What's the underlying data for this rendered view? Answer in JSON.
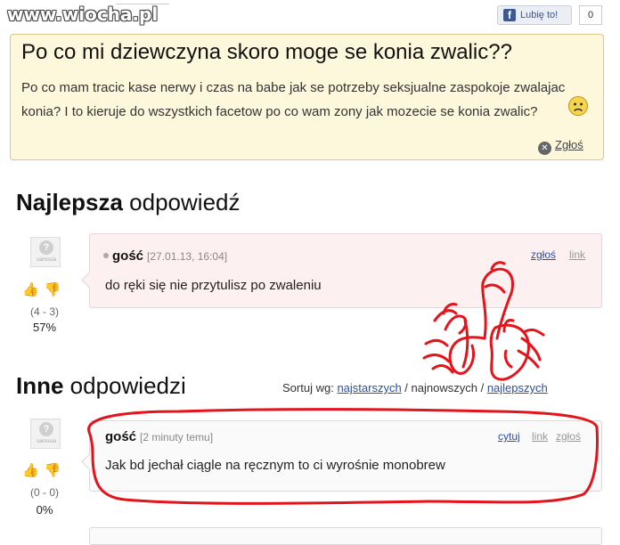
{
  "watermark": "www.wiocha.pl",
  "like_widget": {
    "label": "Lubię to!",
    "count": "0",
    "brand_color": "#3b5998"
  },
  "question": {
    "title": "Po co mi dziewczyna skoro moge se konia zwalic??",
    "body": "Po co mam tracic kase nerwy i czas na babe jak se potrzeby seksjualne zaspokoje zwalajac konia? I to kieruje do wszystkich facetow po co wam zony jak mozecie se konia zwalic?",
    "report_label": "Zgłoś",
    "emoticon": "sad-face-icon"
  },
  "best_answer": {
    "heading_bold": "Najlepsza",
    "heading_rest": " odpowiedź",
    "author": "gość",
    "date": "[27.01.13, 16:04]",
    "actions": [
      "zgłoś",
      "link"
    ],
    "text": "do ręki się nie przytulisz po zwaleniu",
    "votes": "(4 - 3)",
    "percent": "57%",
    "avatar_text": "samosia"
  },
  "other_answers": {
    "heading_bold": "Inne",
    "heading_rest": " odpowiedzi",
    "sort": {
      "label": "Sortuj wg:",
      "options": [
        "najstarszych",
        "najnowszych",
        "najlepszych"
      ],
      "separator": " / "
    },
    "items": [
      {
        "author": "gość",
        "date": "[2 minuty temu]",
        "actions": [
          "cytuj",
          "link",
          "zgłoś"
        ],
        "text": "Jak bd jechał ciągle na ręcznym to ci wyrośnie monobrew",
        "votes": "(0 - 0)",
        "percent": "0%",
        "avatar_text": "samosia"
      }
    ]
  },
  "colors": {
    "question_bg": "#fdf7dc",
    "best_bg": "#fdf0f1",
    "link": "#2f4f9f",
    "scribble": "#e3141b"
  }
}
